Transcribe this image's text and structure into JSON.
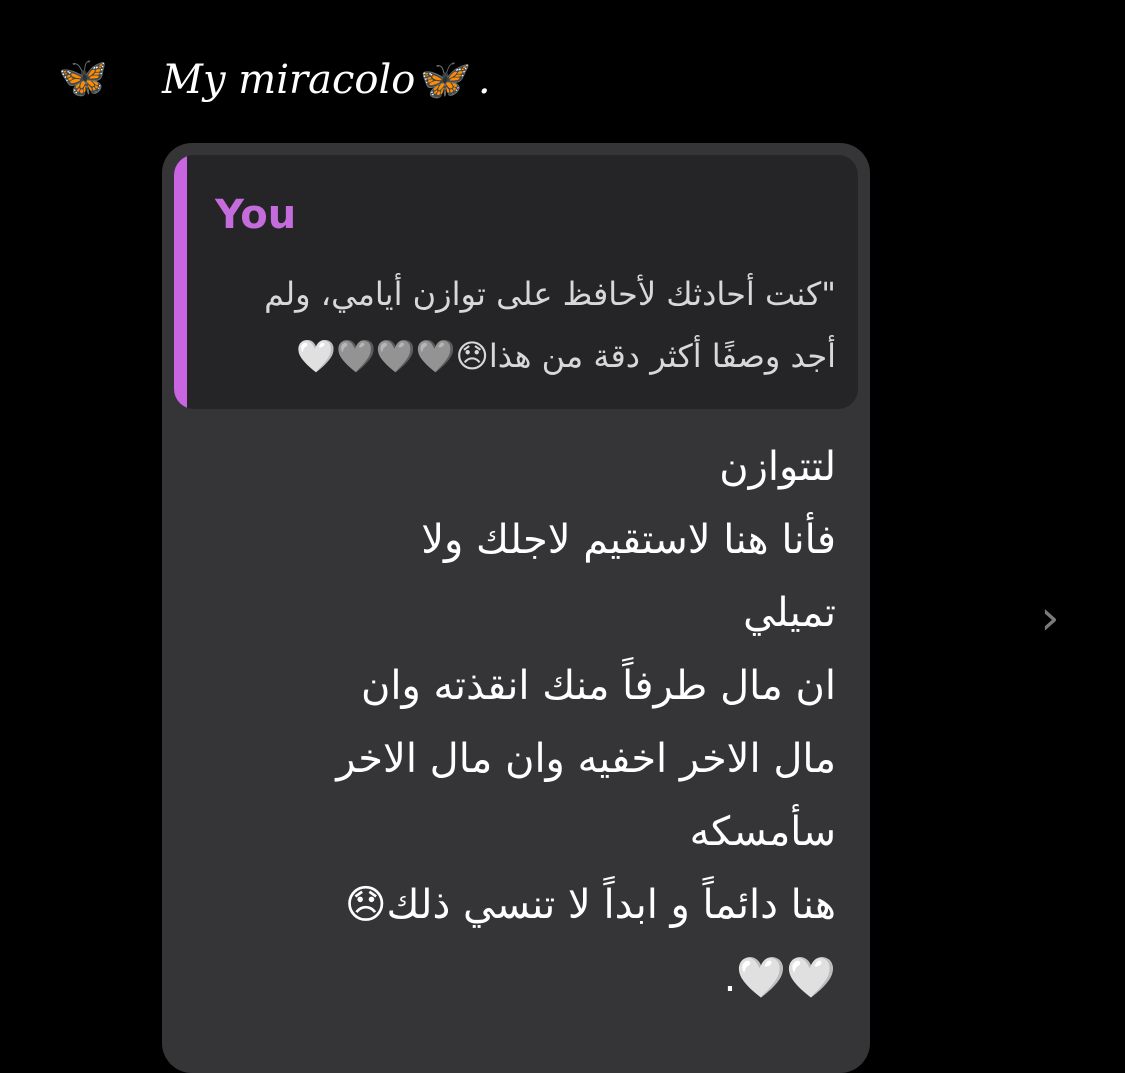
{
  "header": {
    "avatar_icon": "butterfly-icon",
    "sender_name": "My miracolo🦋 ."
  },
  "reply": {
    "author": "You",
    "author_color": "#c56cdc",
    "accent_bar_color": "#c965e1",
    "line1": "\"كنت أحادثك لأحافظ على توازن أيامي، ولم",
    "line2": "أجد وصفًا أكثر دقة من هذا😞🩶🩶🩶🤍"
  },
  "message": {
    "text": "لتتوازن\nفأنا هنا لاستقيم لاجلك ولا\nتميلي\nان مال طرفاً منك انقذته وان\nمال الاخر اخفيه وان مال الاخر\nسأمسكه\nهنا دائماً و ابداً لا تنسي ذلك😞\n🤍🤍."
  },
  "nav": {
    "next_icon": "chevron-right-icon",
    "next_glyph": "›"
  },
  "colors": {
    "background": "#000000",
    "bubble": "#353437",
    "reply_box": "#252427"
  }
}
